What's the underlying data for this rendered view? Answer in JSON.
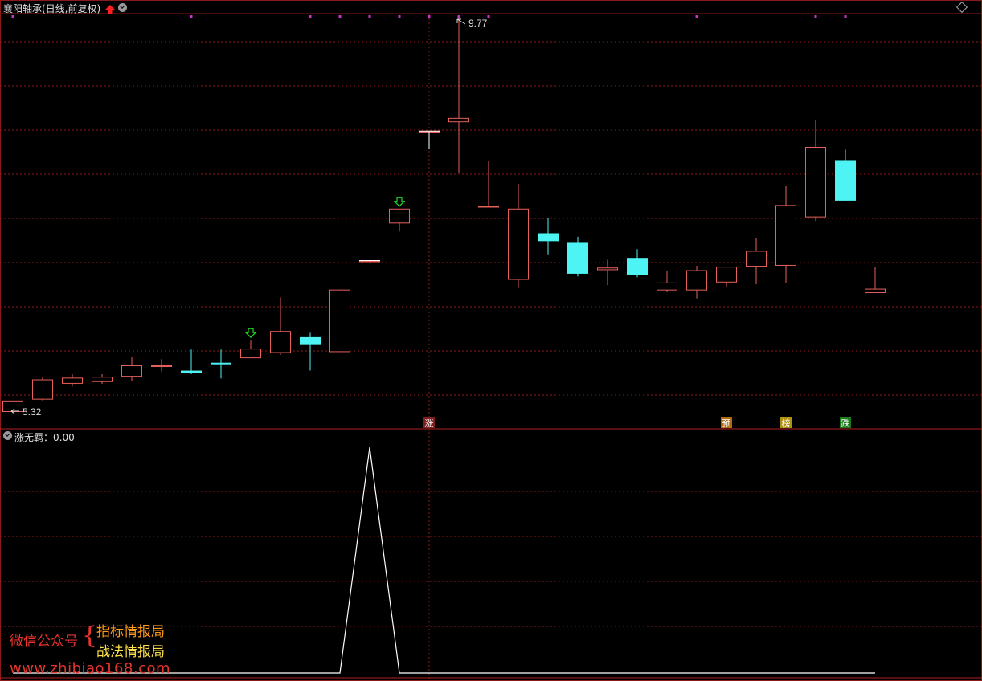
{
  "header": {
    "title": "襄阳轴承(日线,前复权)"
  },
  "indicator": {
    "title": "涨无羁：0.00"
  },
  "watermark": {
    "line1": "微信公众号",
    "brace": "{",
    "line2": "指标情报局",
    "line3": "战法情报局",
    "url": "www.zhibiao168.com"
  },
  "colors": {
    "up": "#e8605a",
    "down": "#4ef3f3",
    "grid": "#8b1a1a",
    "marker": "#cc33cc",
    "indicator_line": "#ffffff",
    "signal_arrow": "#22dd22"
  },
  "chart_data": {
    "type": "candlestick",
    "ylim": [
      5.0,
      10.0
    ],
    "high_label": "9.77",
    "low_label": "5.32",
    "candles": [
      {
        "o": 5.32,
        "c": 5.44,
        "h": 5.44,
        "l": 5.3
      },
      {
        "o": 5.46,
        "c": 5.68,
        "h": 5.71,
        "l": 5.44
      },
      {
        "o": 5.64,
        "c": 5.7,
        "h": 5.74,
        "l": 5.6
      },
      {
        "o": 5.66,
        "c": 5.71,
        "h": 5.74,
        "l": 5.63
      },
      {
        "o": 5.72,
        "c": 5.84,
        "h": 5.94,
        "l": 5.66
      },
      {
        "o": 5.84,
        "c": 5.84,
        "h": 5.91,
        "l": 5.77
      },
      {
        "o": 5.78,
        "c": 5.75,
        "h": 6.02,
        "l": 5.74
      },
      {
        "o": 5.87,
        "c": 5.86,
        "h": 6.02,
        "l": 5.69
      },
      {
        "o": 5.93,
        "c": 6.03,
        "h": 6.13,
        "l": 5.93
      },
      {
        "o": 5.99,
        "c": 6.23,
        "h": 6.61,
        "l": 5.96
      },
      {
        "o": 6.16,
        "c": 6.08,
        "h": 6.21,
        "l": 5.78
      },
      {
        "o": 6.0,
        "c": 6.7,
        "h": 6.7,
        "l": 6.0
      },
      {
        "o": 7.03,
        "c": 7.03,
        "h": 7.03,
        "l": 7.03
      },
      {
        "o": 7.46,
        "c": 7.62,
        "h": 7.62,
        "l": 7.36
      },
      {
        "o": 8.5,
        "c": 8.5,
        "h": 8.5,
        "l": 8.3
      },
      {
        "o": 8.61,
        "c": 8.65,
        "h": 9.77,
        "l": 8.03
      },
      {
        "o": 7.65,
        "c": 7.65,
        "h": 8.16,
        "l": 7.65
      },
      {
        "o": 6.82,
        "c": 7.62,
        "h": 7.9,
        "l": 6.72
      },
      {
        "o": 7.34,
        "c": 7.25,
        "h": 7.51,
        "l": 7.1
      },
      {
        "o": 7.24,
        "c": 6.88,
        "h": 7.3,
        "l": 6.85
      },
      {
        "o": 6.93,
        "c": 6.95,
        "h": 7.04,
        "l": 6.75
      },
      {
        "o": 7.06,
        "c": 6.87,
        "h": 7.16,
        "l": 6.84
      },
      {
        "o": 6.7,
        "c": 6.78,
        "h": 6.91,
        "l": 6.68
      },
      {
        "o": 6.7,
        "c": 6.92,
        "h": 6.97,
        "l": 6.6
      },
      {
        "o": 6.79,
        "c": 6.96,
        "h": 6.96,
        "l": 6.73
      },
      {
        "o": 6.97,
        "c": 7.14,
        "h": 7.29,
        "l": 6.76
      },
      {
        "o": 6.98,
        "c": 7.66,
        "h": 7.88,
        "l": 6.77
      },
      {
        "o": 7.53,
        "c": 8.32,
        "h": 8.62,
        "l": 7.48
      },
      {
        "o": 8.17,
        "c": 7.71,
        "h": 8.29,
        "l": 7.71
      },
      {
        "o": 6.67,
        "c": 6.71,
        "h": 6.96,
        "l": 6.67
      }
    ],
    "top_markers": [
      0,
      6,
      10,
      11,
      12,
      13,
      14,
      15,
      16,
      23,
      27,
      28
    ],
    "signal_arrows": [
      8,
      13
    ],
    "bottom_labels": [
      {
        "i": 14,
        "text": "涨",
        "bg": "#7a2020",
        "fg": "#ffffff"
      },
      {
        "i": 24,
        "text": "预",
        "bg": "#b06a10",
        "fg": "#ffffff"
      },
      {
        "i": 26,
        "text": "榜",
        "bg": "#b09010",
        "fg": "#ffffff"
      },
      {
        "i": 28,
        "text": "跌",
        "bg": "#1d7a1d",
        "fg": "#ffffff"
      }
    ],
    "indicator_values": [
      0,
      0,
      0,
      0,
      0,
      0,
      0,
      0,
      0,
      0,
      0,
      0,
      1,
      0,
      0,
      0,
      0,
      0,
      0,
      0,
      0,
      0,
      0,
      0,
      0,
      0,
      0,
      0,
      0,
      0
    ],
    "indicator_ylim": [
      0,
      1
    ]
  }
}
